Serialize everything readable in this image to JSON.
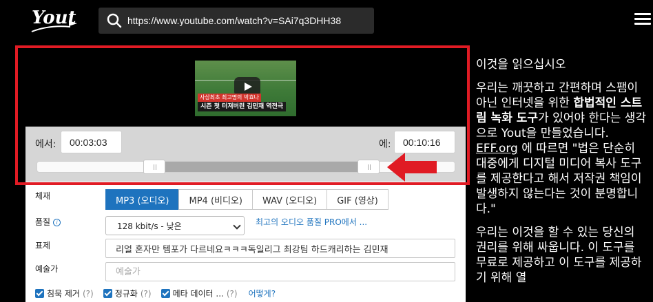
{
  "header": {
    "logo_text": "Yout",
    "url_value": "https://www.youtube.com/watch?v=SAi7q3DHH38"
  },
  "video": {
    "thumb_caption_top": "사상최초 최고명의 박효나",
    "thumb_caption_main": "시즌 첫 터져버린 김민재 역전극"
  },
  "trim": {
    "from_label": "에서:",
    "from_value": "00:03:03",
    "to_label": "에:",
    "to_value": "00:10:16",
    "range_start_fraction": 0.29,
    "range_end_fraction": 0.81
  },
  "form": {
    "format_label": "체재",
    "formats": [
      "MP3 (오디오)",
      "MP4 (비디오)",
      "WAV (오디오)",
      "GIF (영상)"
    ],
    "active_format": "MP3 (오디오)",
    "quality_label": "품질",
    "quality_value": "128 kbit/s - 낮은",
    "pro_link": "최고의 오디오 품질 PRO에서 ...",
    "title_label": "표제",
    "title_value": "리얼 혼자만 템포가 다르네요ㅋㅋㅋ독일리그 최강팀 하드캐리하는 김민재",
    "artist_label": "예술가",
    "artist_placeholder": "예술가",
    "checks": [
      {
        "label": "침묵 제거",
        "help": "(?)"
      },
      {
        "label": "정규화",
        "help": "(?)"
      },
      {
        "label": "메타 데이터 ...",
        "help": "(?)"
      }
    ],
    "how_link": "어떻게?"
  },
  "sidebar": {
    "heading": "이것을 읽으십시오",
    "para1_a": "우리는 깨끗하고 간편하며 스팸이 아닌 인터넷을 위한 ",
    "para1_bold": "합법적인 스트림 녹화 도구",
    "para1_b": "가 있어야 한다는 생각으로 Yout을 만들었습니다. ",
    "para1_link": "EFF.org",
    "para1_c": " 에 따르면 \"법은 단순히 대중에게 디지털 미디어 복사 도구를 제공한다고 해서 저작권 책임이 발생하지 않는다는 것이 분명합니다.\"",
    "para2": "우리는 이것을 할 수 있는 당신의 권리를 위해 싸웁니다. 이 도구를 무료로 제공하고 이 도구를 제공하기 위해 열"
  },
  "colors": {
    "accent_blue": "#1e73be",
    "annotation_red": "#e01b24",
    "background": "#000000"
  }
}
